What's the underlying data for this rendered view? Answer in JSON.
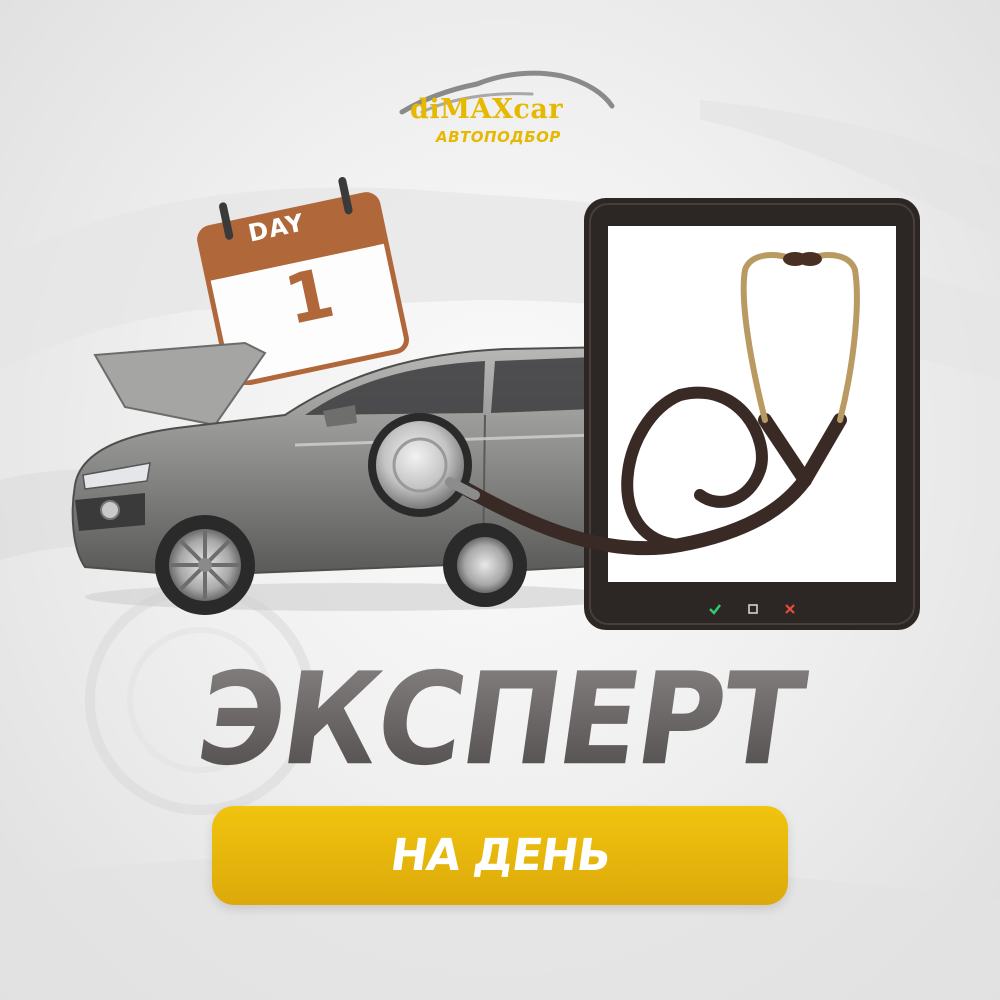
{
  "logo": {
    "brand": "diMAXcar",
    "subtitle": "АВТОПОДБОР",
    "icon": "car-silhouette-icon"
  },
  "calendar": {
    "label": "DAY",
    "number": "1",
    "icon": "calendar-icon"
  },
  "tablet": {
    "icons": [
      "checkmark-icon",
      "square-icon",
      "cross-icon"
    ]
  },
  "headline": "ЭКСПЕРТ",
  "cta": {
    "label": "НА ДЕНЬ"
  },
  "colors": {
    "accent": "#f1c40f",
    "calendar": "#b0683a",
    "headline": "#5e5a5a",
    "tablet": "#2c2624"
  }
}
